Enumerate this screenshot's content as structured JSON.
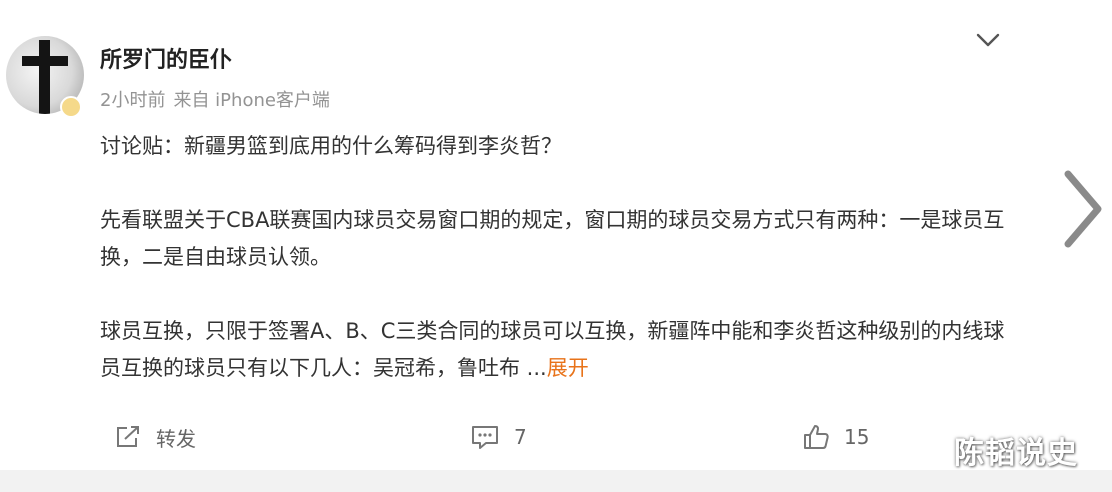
{
  "post": {
    "author": "所罗门的臣仆",
    "time": "2小时前",
    "source": "来自 iPhone客户端",
    "paragraphs": [
      "讨论贴：新疆男篮到底用的什么筹码得到李炎哲？",
      "先看联盟关于CBA联赛国内球员交易窗口期的规定，窗口期的球员交易方式只有两种：一是球员互换，二是自由球员认领。",
      "球员互换，只限于签署A、B、C三类合同的球员可以互换，新疆阵中能和李炎哲这种级别的内线球员互换的球员只有以下几人：吴冠希，鲁吐布 ..."
    ],
    "expand_label": "展开"
  },
  "actions": {
    "repost_label": "转发",
    "comment_count": "7",
    "like_count": "15"
  },
  "watermark": "陈韬说史",
  "icons": {
    "more": "chevron-down-icon",
    "next": "chevron-right-icon",
    "repost": "share-icon",
    "comment": "comment-icon",
    "like": "thumbs-up-icon"
  },
  "colors": {
    "link": "#e8731a",
    "muted": "#939393",
    "text": "#333333"
  }
}
